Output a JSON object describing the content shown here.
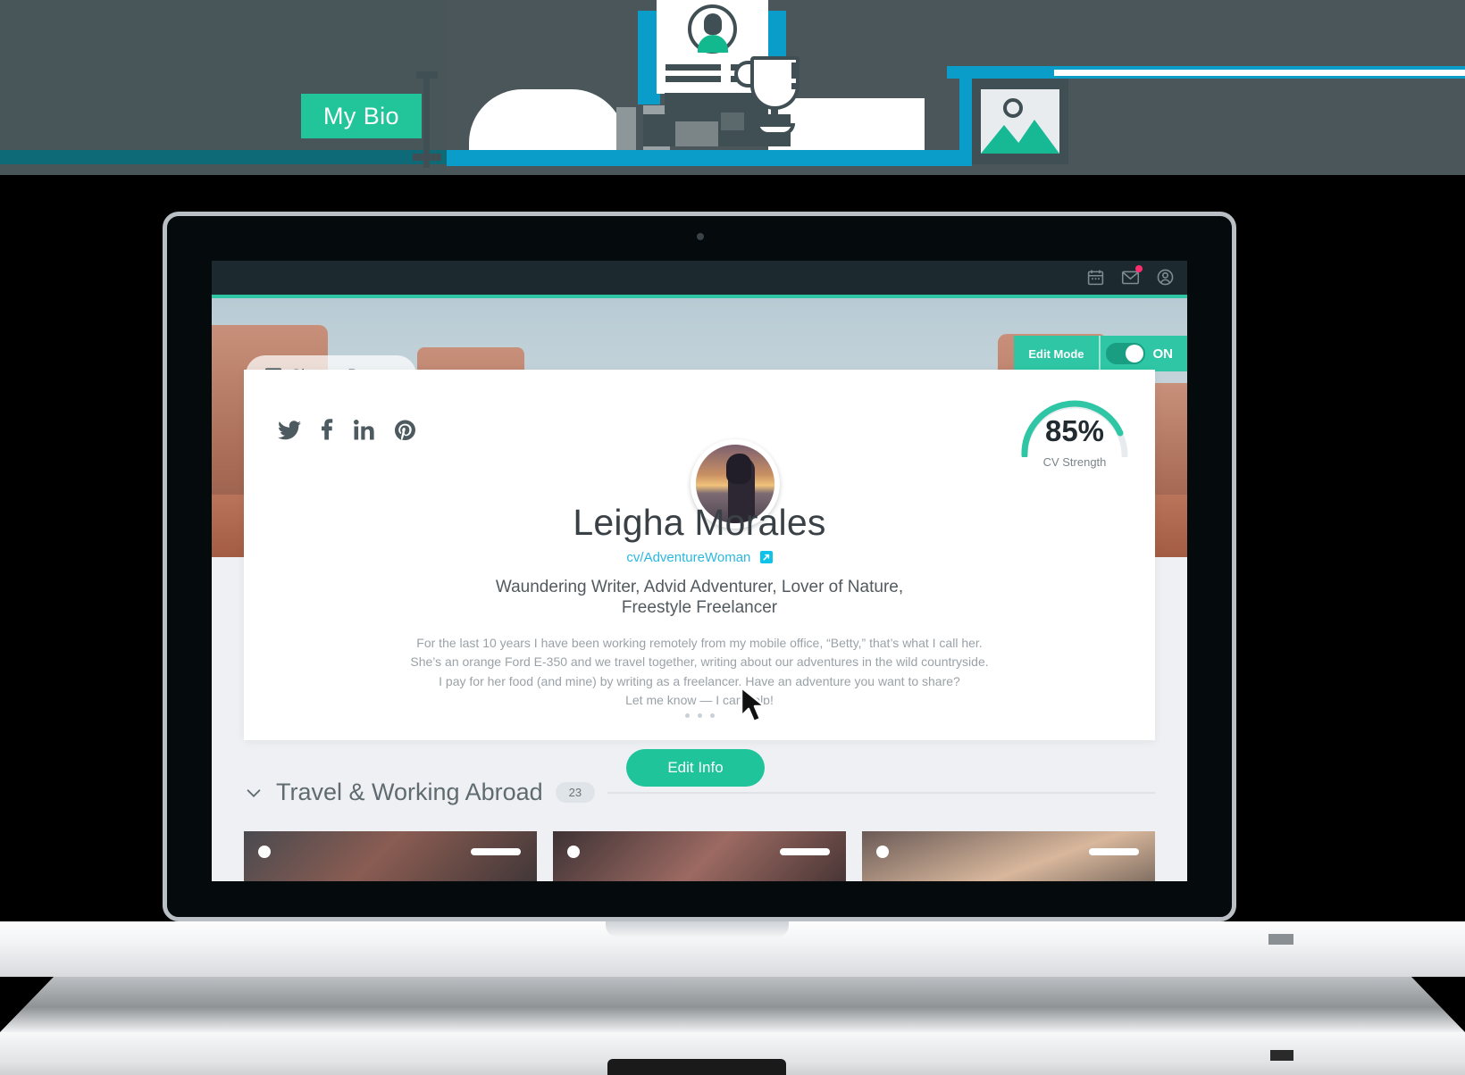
{
  "hero": {
    "badge_label": "My Bio",
    "illustration_name": "resume-coffee-illustration",
    "image_icon_name": "image-placeholder-icon"
  },
  "appbar": {
    "icons": [
      {
        "name": "calendar-icon",
        "label": "Calendar"
      },
      {
        "name": "mail-icon",
        "label": "Messages",
        "badge": true
      },
      {
        "name": "account-icon",
        "label": "Account"
      }
    ]
  },
  "banner": {
    "change_banner_label": "Change Banner",
    "change_banner_icon": "image-icon"
  },
  "edit_mode": {
    "label": "Edit Mode",
    "state_label": "ON",
    "enabled": true
  },
  "profile": {
    "avatar_name": "profile-avatar",
    "name": "Leigha Morales",
    "handle": "cv/AdventureWoman",
    "handle_icon": "external-link-icon",
    "tagline_line1": "Waundering Writer, Advid Adventurer, Lover of Nature,",
    "tagline_line2": "Freestyle Freelancer",
    "bio_lines": [
      "For the last 10 years I have been working remotely from my mobile office, “Betty,” that’s what I call her.",
      "She’s an orange Ford E-350 and we travel together, writing about our adventures in the wild countryside.",
      "I pay for her food (and mine) by writing as a freelancer. Have an adventure you want to share?",
      "Let me know  — I can help!"
    ],
    "carousel_dots": 3,
    "edit_info_label": "Edit Info",
    "social": [
      {
        "name": "twitter-icon",
        "label": "Twitter"
      },
      {
        "name": "facebook-icon",
        "label": "Facebook"
      },
      {
        "name": "linkedin-icon",
        "label": "LinkedIn"
      },
      {
        "name": "pinterest-icon",
        "label": "Pinterest"
      }
    ]
  },
  "cv_strength": {
    "value_label": "85%",
    "value": 85,
    "caption": "CV Strength",
    "accent_color": "#2ec6a4",
    "track_color": "#e8ebee"
  },
  "section": {
    "title": "Travel & Working Abroad",
    "count": "23",
    "collapse_icon": "chevron-down-icon",
    "cards": [
      {
        "name": "travel-card-1"
      },
      {
        "name": "travel-card-2"
      },
      {
        "name": "travel-card-3"
      }
    ]
  },
  "colors": {
    "accent_green": "#2ec6a4",
    "accent_blue": "#0b9dc9",
    "link_blue": "#2bb8e0",
    "dark_slate": "#3f4f54",
    "appbar": "#1c2a2f"
  }
}
